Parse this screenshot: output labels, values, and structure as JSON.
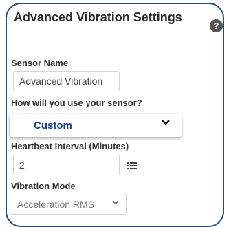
{
  "panel": {
    "title": "Advanced Vibration Settings",
    "help_icon": "question-icon",
    "help_glyph": "?"
  },
  "fields": {
    "sensor_name": {
      "label": "Sensor Name",
      "value": "Advanced Vibration"
    },
    "usage": {
      "label": "How will you use your sensor?",
      "selected": "Custom",
      "chevron": "chevron-down-icon"
    },
    "heartbeat": {
      "label": "Heartbeat Interval (Minutes)",
      "value": "2",
      "icon": "list-icon"
    },
    "vibration_mode": {
      "label": "Vibration Mode",
      "selected": "Acceleration RMS",
      "chevron": "chevron-down-icon"
    }
  },
  "colors": {
    "border": "#1f4f7a",
    "select_text": "#1a3e8c",
    "help_bg": "#555555"
  }
}
